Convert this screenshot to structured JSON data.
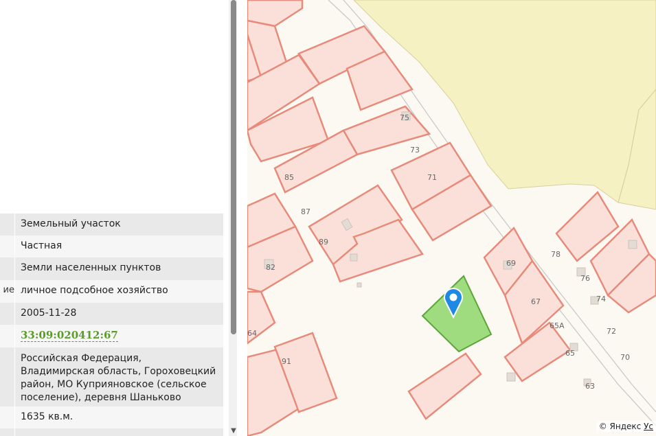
{
  "attributes": [
    {
      "key": "",
      "value": "Земельный участок"
    },
    {
      "key": "",
      "value": "Частная"
    },
    {
      "key": "",
      "value": "Земли населенных пунктов"
    },
    {
      "key": "ие",
      "value": "личное подсобное хозяйство"
    },
    {
      "key": "",
      "value": "2005-11-28"
    },
    {
      "key": "",
      "value": "33:09:020412:67"
    },
    {
      "key": "",
      "value": "Российская Федерация, Владимирская область, Гороховецкий район, МО Куприяновское (сельское поселение), деревня Шаньково"
    },
    {
      "key": "",
      "value": "1635 кв.м."
    }
  ],
  "scrollbar": {
    "down_arrow": "▼"
  },
  "map": {
    "plot_numbers": [
      "75",
      "73",
      "71",
      "85",
      "87",
      "89",
      "82",
      "69",
      "78",
      "76",
      "74",
      "67",
      "65А",
      "72",
      "65",
      "70",
      "63",
      "91",
      "64"
    ],
    "highlight_color": "#9fdc80",
    "marker_color": "#1e88e5",
    "copyright_prefix": "© Яндекс",
    "copyright_link": "Ус"
  }
}
